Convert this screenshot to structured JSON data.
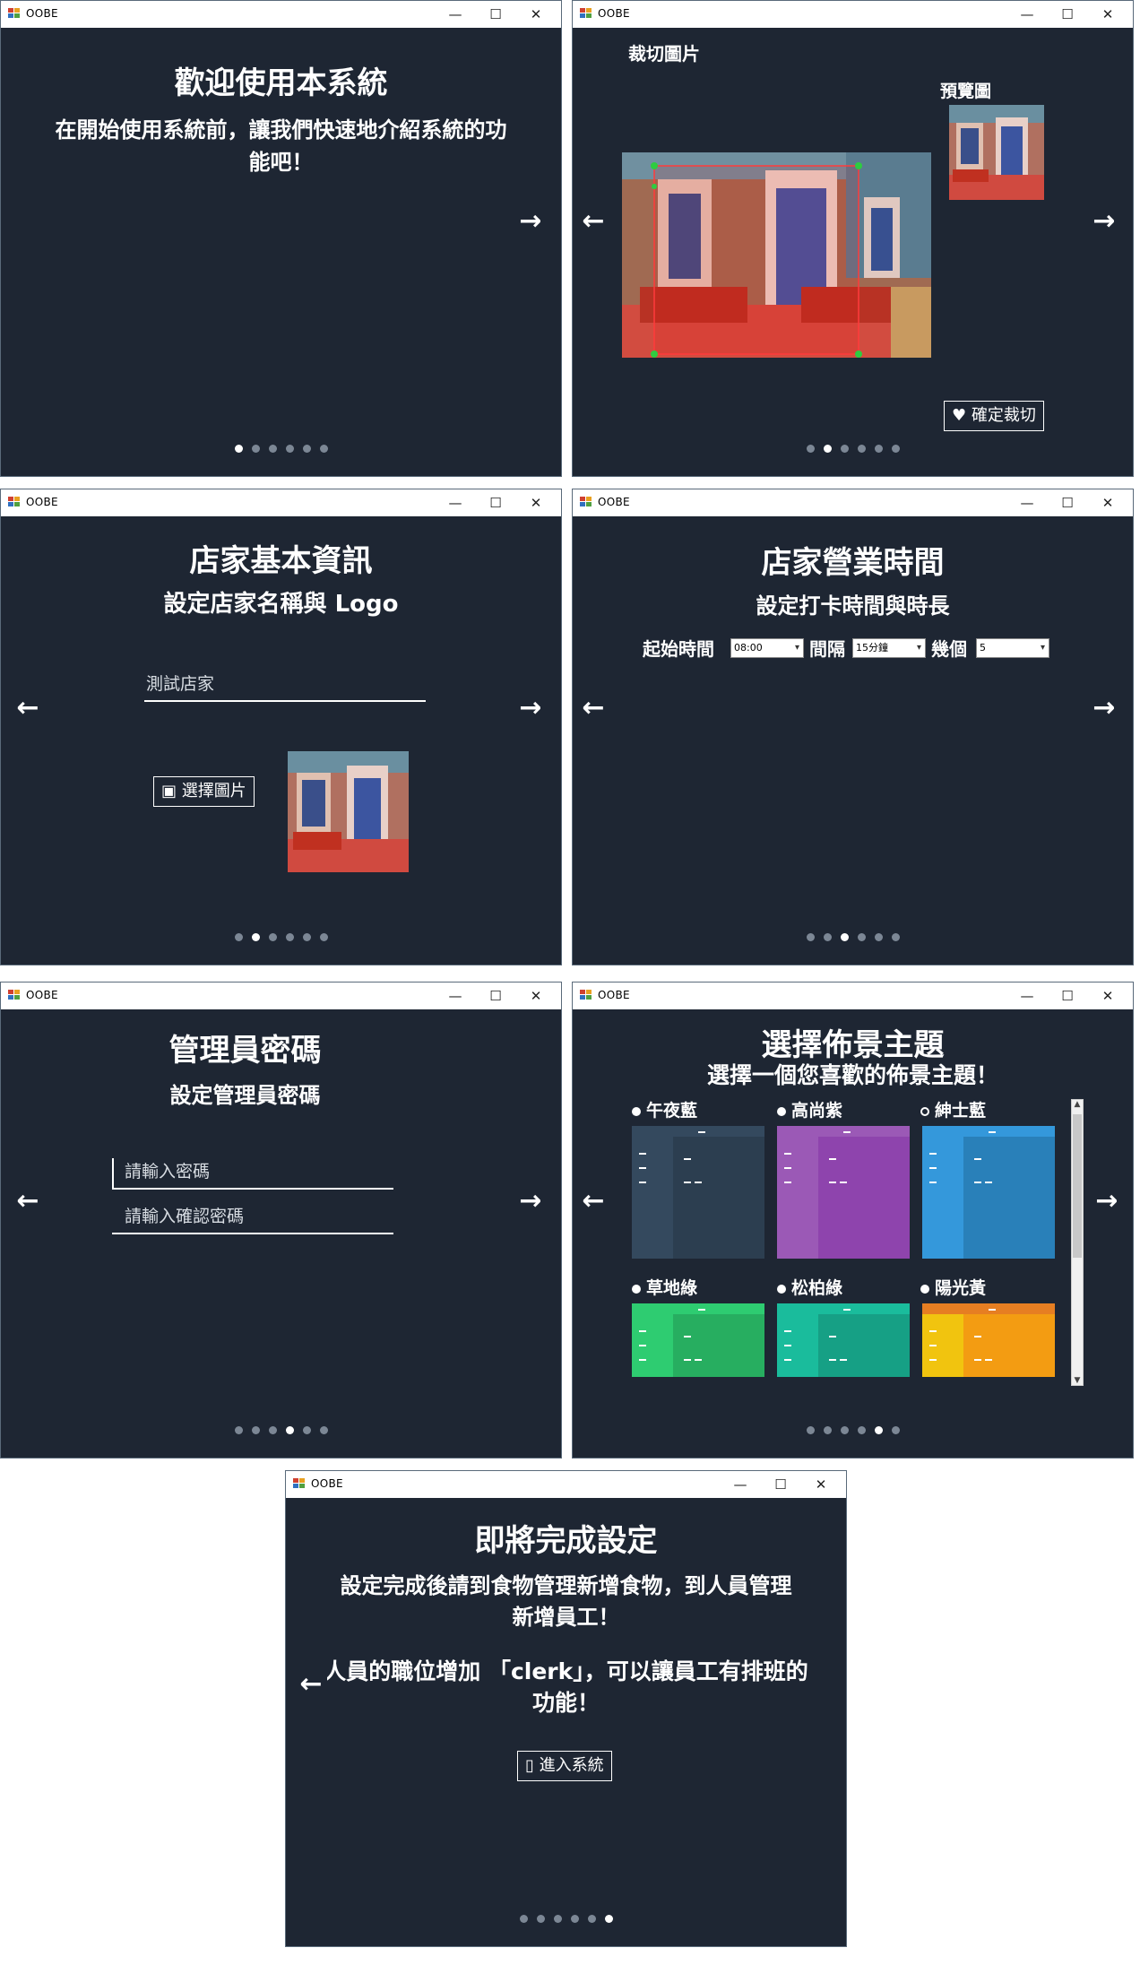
{
  "window": {
    "app_title": "OOBE",
    "minimize": "—",
    "maximize": "☐",
    "close": "✕"
  },
  "nav": {
    "prev": "←",
    "next": "→"
  },
  "step1": {
    "title": "歡迎使用本系統",
    "subtitle_line1": "在開始使用系統前，讓我們快速地介紹系統的功",
    "subtitle_line2": "能吧！",
    "active_dot": 1
  },
  "step2": {
    "crop_label": "裁切圖片",
    "preview_label": "預覽圖",
    "confirm_button": "確定裁切",
    "confirm_icon": "heart-icon",
    "active_dot": 2
  },
  "step3": {
    "title": "店家基本資訊",
    "subtitle": "設定店家名稱與 Logo",
    "store_name_value": "測試店家",
    "select_image_button": "選擇圖片",
    "select_image_icon": "image-icon",
    "active_dot": 2
  },
  "step4": {
    "title": "店家營業時間",
    "subtitle": "設定打卡時間與時長",
    "start_time_label": "起始時間",
    "start_time_value": "08:00",
    "interval_label": "間隔",
    "interval_value": "15分鐘",
    "count_label": "幾個",
    "count_value": "5",
    "active_dot": 3
  },
  "step5": {
    "title": "管理員密碼",
    "subtitle": "設定管理員密碼",
    "password_placeholder": "請輸入密碼",
    "confirm_password_placeholder": "請輸入確認密碼",
    "active_dot": 4
  },
  "step6": {
    "title": "選擇佈景主題",
    "subtitle": "選擇一個您喜歡的佈景主題！",
    "themes": [
      {
        "name": "午夜藍",
        "selected": true,
        "color_bar": "#2c3e50",
        "color_side": "#34495e",
        "color_main": "#2c3e50"
      },
      {
        "name": "高尚紫",
        "selected": true,
        "color_bar": "#8e44ad",
        "color_side": "#9b59b6",
        "color_main": "#8e44ad"
      },
      {
        "name": "紳士藍",
        "selected": false,
        "color_bar": "#2980b9",
        "color_side": "#3498db",
        "color_main": "#2980b9"
      },
      {
        "name": "草地綠",
        "selected": true,
        "color_bar": "#27ae60",
        "color_side": "#2ecc71",
        "color_main": "#27ae60"
      },
      {
        "name": "松柏綠",
        "selected": true,
        "color_bar": "#16a085",
        "color_side": "#1abc9c",
        "color_main": "#16a085"
      },
      {
        "name": "陽光黃",
        "selected": true,
        "color_bar": "#e67e22",
        "color_side": "#f1c40f",
        "color_main": "#f39c12"
      }
    ],
    "active_dot": 5
  },
  "step7": {
    "title": "即將完成設定",
    "text1_line1": "設定完成後請到食物管理新增食物，到人員管理",
    "text1_line2": "新增員工！",
    "text2_line1": "人員的職位增加 「clerk」，可以讓員工有排班的",
    "text2_line2": "功能！",
    "enter_button": "進入系統",
    "enter_icon": "door-icon",
    "active_dot": 6
  },
  "colors": {
    "background": "#1e2633",
    "text": "#ffffff",
    "dot_inactive": "#7c8795",
    "dot_active": "#ffffff"
  }
}
